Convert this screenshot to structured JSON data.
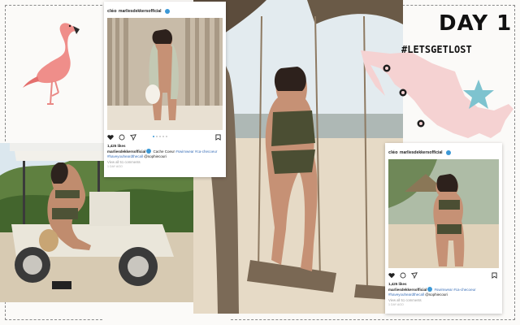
{
  "title": {
    "day": "DAY 1",
    "hashtag": "#LETSGETLOST"
  },
  "post_1": {
    "logo": "cléo",
    "username": "marliesdekkersofficial",
    "likes": "1,425 likes",
    "caption_user": "marliesdekkersofficial",
    "caption_text": " Cache Coeur ",
    "caption_tags": "#swimwear #ca-checoeur #haveyouheardthecall",
    "caption_mention": " @sophiecouri",
    "comments": "View all 51 comments",
    "time": "1 DAY AGO"
  },
  "post_2": {
    "logo": "cléo",
    "username": "marliesdekkersofficial",
    "likes": "1,425 likes",
    "caption_user": "marliesdekkersofficial",
    "caption_text": " ",
    "caption_tags": "#swimwear #ca-checoeur #haveyouheardthecall",
    "caption_mention": " @sophiecouri",
    "comments": "View all 51 comments",
    "time": "1 DAY AGO"
  },
  "colors": {
    "flamingo": "#ef8e8a",
    "map": "#f6d3d3",
    "starfish": "#7ec3cf",
    "verified": "#3b98d6",
    "tag": "#3b70b8"
  },
  "icons": [
    "heart-icon",
    "comment-icon",
    "share-icon",
    "save-icon",
    "verified-icon",
    "flamingo-illustration",
    "starfish-illustration",
    "map-marker-icon"
  ]
}
